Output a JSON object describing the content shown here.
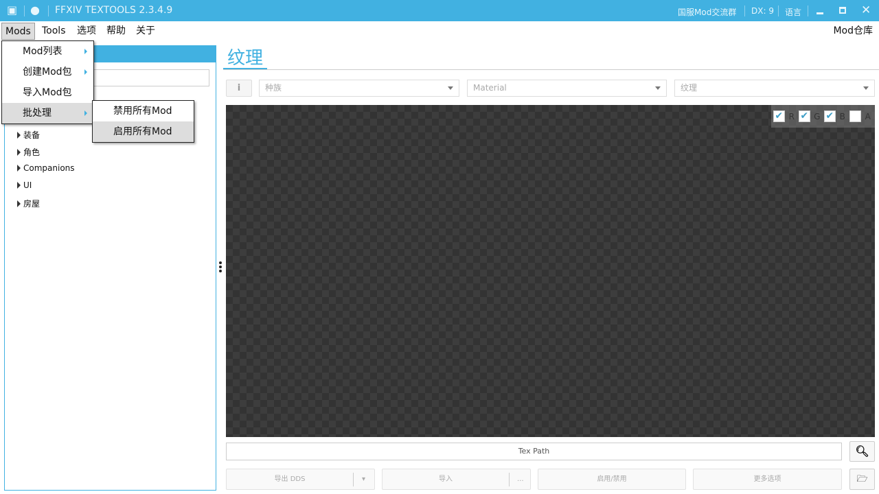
{
  "titlebar": {
    "title": "FFXIV TEXTOOLS 2.3.4.9",
    "community": "国服Mod交流群",
    "dx": "DX: 9",
    "language": "语言",
    "icons": [
      "discord-icon",
      "github-icon",
      "minimize-icon",
      "maximize-icon",
      "close-icon"
    ]
  },
  "menubar": {
    "items": [
      "Mods",
      "Tools",
      "选项",
      "帮助",
      "关于"
    ],
    "right": "Mod仓库"
  },
  "mods_menu": {
    "items": [
      {
        "label": "Mod列表",
        "submenu": true
      },
      {
        "label": "创建Mod包",
        "submenu": true
      },
      {
        "label": "导入Mod包",
        "submenu": false
      },
      {
        "label": "批处理",
        "submenu": true
      }
    ]
  },
  "batch_submenu": {
    "items": [
      "禁用所有Mod",
      "启用所有Mod"
    ]
  },
  "tree": {
    "items": [
      "装备",
      "角色",
      "Companions",
      "UI",
      "房屋"
    ]
  },
  "main": {
    "title": "纹理",
    "info": "i",
    "dropdowns": [
      "种族",
      "Material",
      "纹理"
    ],
    "channels": [
      {
        "label": "R",
        "checked": true
      },
      {
        "label": "G",
        "checked": true
      },
      {
        "label": "B",
        "checked": true
      },
      {
        "label": "A",
        "checked": false
      }
    ],
    "tex_path": "Tex Path",
    "buttons": {
      "export": "导出 DDS",
      "import": "导入",
      "import_more": "...",
      "toggle": "启用/禁用",
      "more": "更多选项"
    }
  },
  "colors": {
    "accent": "#41b1e1"
  }
}
